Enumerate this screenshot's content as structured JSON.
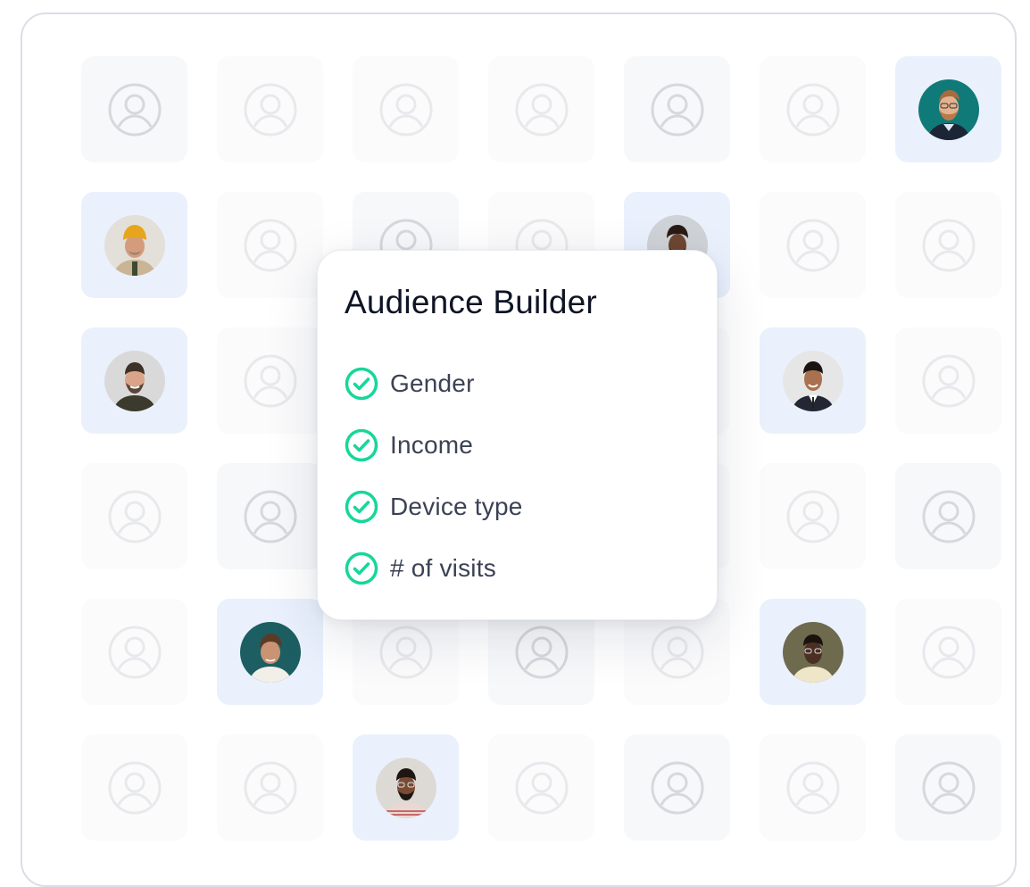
{
  "card": {
    "title": "Audience Builder",
    "criteria": [
      {
        "label": "Gender",
        "checked": true
      },
      {
        "label": "Income",
        "checked": true
      },
      {
        "label": "Device type",
        "checked": true
      },
      {
        "label": "# of visits",
        "checked": true
      }
    ]
  },
  "colors": {
    "check": "#18d69a",
    "person_tile": "#eaf1fd",
    "empty_tile": "#f7f8fa",
    "frame_border": "#dcdde5"
  },
  "grid": {
    "rows": 6,
    "columns": 7,
    "tiles": [
      [
        "empty",
        "empty-faint",
        "empty-faint",
        "empty-faint",
        "empty",
        "empty-faint",
        "person-1"
      ],
      [
        "person-2",
        "empty-faint",
        "empty",
        "empty-faint",
        "person-3",
        "empty-faint",
        "empty-faint"
      ],
      [
        "person-4",
        "empty-faint",
        "empty",
        "empty-faint",
        "empty-faint",
        "person-5",
        "empty-faint"
      ],
      [
        "empty-faint",
        "empty",
        "empty",
        "empty-faint",
        "empty-faint",
        "empty-faint",
        "empty"
      ],
      [
        "empty-faint",
        "person-6",
        "empty-faint",
        "empty",
        "empty-faint",
        "person-7",
        "empty-faint"
      ],
      [
        "empty-faint",
        "empty-faint",
        "person-8",
        "empty-faint",
        "empty",
        "empty-faint",
        "empty"
      ]
    ]
  },
  "icons": {
    "placeholder": "user-circle-icon",
    "check": "check-circle-icon"
  }
}
